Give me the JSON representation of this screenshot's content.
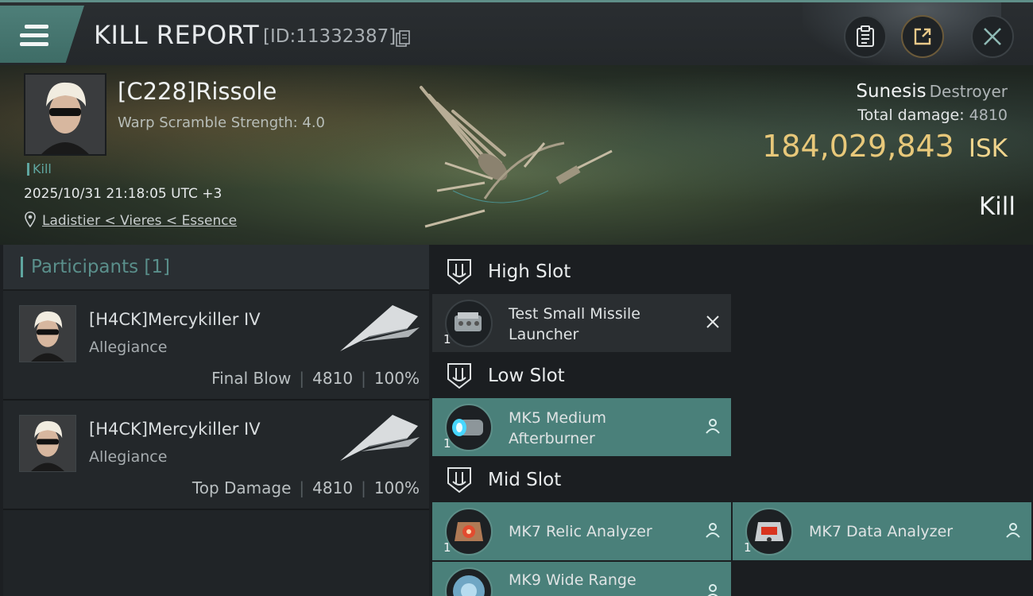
{
  "header": {
    "title": "KILL REPORT",
    "report_id": "[ID:11332387]"
  },
  "victim": {
    "name": "[C228]Rissole",
    "warp_scramble": "Warp Scramble Strength: 4.0",
    "tag": "Kill",
    "datetime": "2025/10/31 21:18:05 UTC +3",
    "location": "Ladistier < Vieres < Essence",
    "ship_name": "Sunesis",
    "ship_class": "Destroyer",
    "total_damage_label": "Total damage:",
    "total_damage": "4810",
    "isk_value": "184,029,843",
    "isk_unit": "ISK",
    "result": "Kill"
  },
  "participants": {
    "label": "Participants [1]",
    "items": [
      {
        "name": "[H4CK]Mercykiller IV",
        "corp": "Allegiance",
        "role": "Final Blow",
        "damage": "4810",
        "percent": "100%"
      },
      {
        "name": "[H4CK]Mercykiller IV",
        "corp": "Allegiance",
        "role": "Top Damage",
        "damage": "4810",
        "percent": "100%"
      }
    ]
  },
  "fitting": {
    "high": {
      "label": "High Slot",
      "modules": [
        {
          "name": "Test Small Missile Launcher",
          "qty": "1"
        }
      ]
    },
    "low": {
      "label": "Low Slot",
      "modules": [
        {
          "name": "MK5 Medium Afterburner",
          "qty": "1"
        }
      ]
    },
    "mid": {
      "label": "Mid Slot",
      "modules": [
        {
          "name": "MK7 Relic Analyzer",
          "qty": "1"
        },
        {
          "name": "MK7 Data Analyzer",
          "qty": "1"
        },
        {
          "name": "MK9 Wide Range",
          "qty": ""
        }
      ]
    }
  },
  "colors": {
    "accent": "#4a807a",
    "isk": "#e8c87a",
    "highlight": "#5fa6a0"
  },
  "icons": [
    "menu-icon",
    "copy-icon",
    "clipboard-icon",
    "share-icon",
    "close-icon",
    "location-pin-icon",
    "slot-icon",
    "pilot-icon",
    "destroyed-x-icon"
  ]
}
